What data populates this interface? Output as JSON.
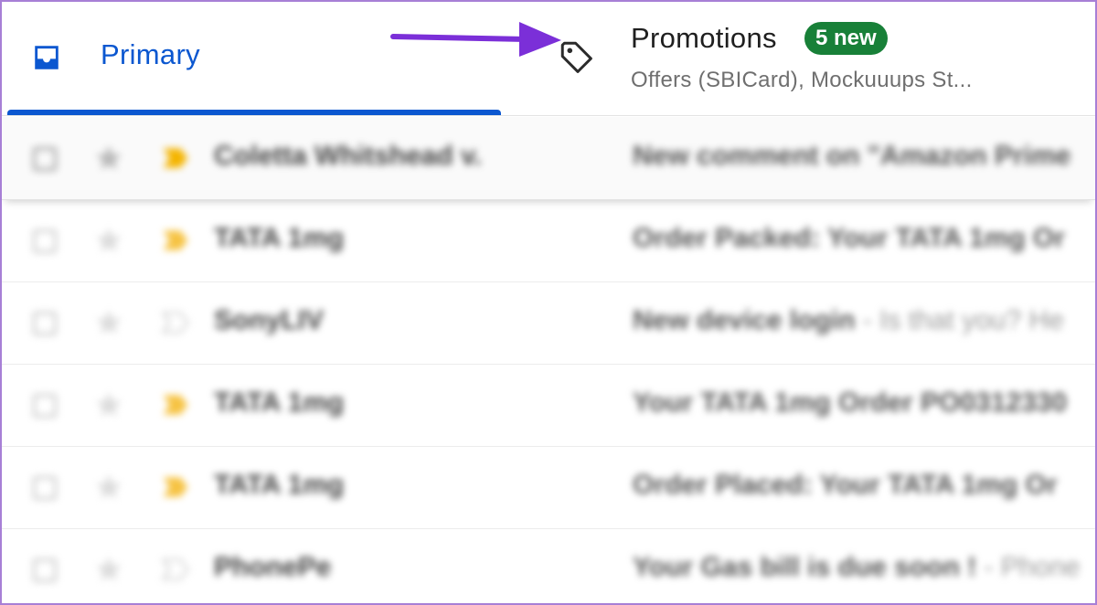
{
  "tabs": {
    "primary": {
      "label": "Primary",
      "icon": "inbox-icon",
      "color": "#0b57d0"
    },
    "promotions": {
      "label": "Promotions",
      "badge": "5 new",
      "badge_color": "#188038",
      "snippet": "Offers (SBICard), Mockuuups St...",
      "icon": "tag-icon"
    }
  },
  "annotation": {
    "arrow_color": "#7b2fd8",
    "icon": "arrow-icon"
  },
  "emails": [
    {
      "sender": "Coletta Whitshead v.",
      "subject": "New comment on \"Amazon Prime",
      "snippet": "",
      "important": true
    },
    {
      "sender": "TATA 1mg",
      "subject": "Order Packed: Your TATA 1mg Or",
      "snippet": "",
      "important": true
    },
    {
      "sender": "SonyLIV",
      "subject": "New device login",
      "snippet": " - Is that you? He",
      "important": false
    },
    {
      "sender": "TATA 1mg",
      "subject": "Your TATA 1mg Order PO0312330",
      "snippet": "",
      "important": true
    },
    {
      "sender": "TATA 1mg",
      "subject": "Order Placed: Your TATA 1mg Or",
      "snippet": "",
      "important": true
    },
    {
      "sender": "PhonePe",
      "subject": "Your Gas bill is due soon !",
      "snippet": " - Phone",
      "important": false
    }
  ]
}
